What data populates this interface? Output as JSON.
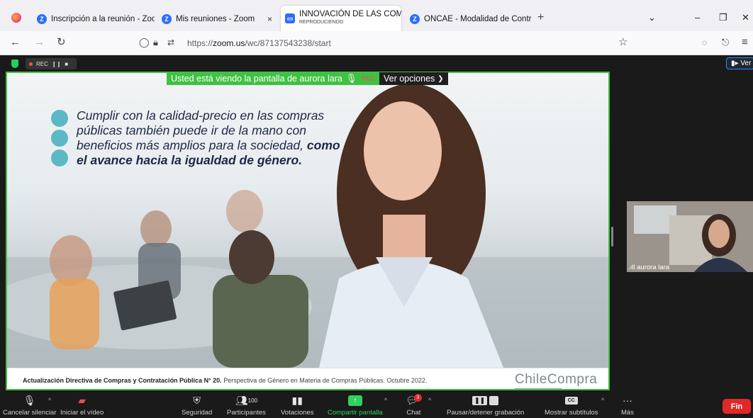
{
  "browser": {
    "tabs": [
      {
        "label": "Inscripción a la reunión - Zoom",
        "close": "×"
      },
      {
        "label": "Mis reuniones - Zoom",
        "close": "×"
      },
      {
        "label": "INNOVACIÓN DE LAS COMPRA",
        "sub": "REPRODUCIENDO",
        "close": "×"
      },
      {
        "label": "ONCAE - Modalidad de Contrat",
        "close": "×"
      }
    ],
    "new_tab": "+",
    "url_prefix": "https://",
    "url_domain": "zoom.us",
    "url_path": "/wc/87137543238/start"
  },
  "zoom": {
    "rec_indicator": "REC",
    "ver_button": "Ver",
    "viewing_banner": "Usted está viendo la pantalla de aurora lara",
    "banner_rec": "REC",
    "options_button": "Ver opciones",
    "participant_name": "aurora lara"
  },
  "slide": {
    "quote_plain": "Cumplir con la calidad-precio en las compras públicas también puede ir de la mano con beneficios más amplios para la sociedad,",
    "quote_bold": "como el avance hacia la igualdad de género.",
    "footer_bold": "Actualización Directiva de Compras y Contratación Pública N° 20.",
    "footer_plain": "Perspectiva de Género en Materia de Compras Públicas. Octubre 2022.",
    "brand": "ChileCompra"
  },
  "toolbar": {
    "mute": "Cancelar silenciar",
    "video": "Iniciar el vídeo",
    "security": "Seguridad",
    "participants": "Participantes",
    "participants_count": "100",
    "polls": "Votaciones",
    "share": "Compartir pantalla",
    "chat": "Chat",
    "chat_badge": "3",
    "record": "Pausar/detener grabación",
    "captions": "Mostrar subtítulos",
    "captions_icon": "CC",
    "more": "Más",
    "end": "Fin"
  },
  "colors": {
    "zoom_green": "#3fc142",
    "zoom_blue": "#2d6bff",
    "end_red": "#e02828",
    "slide_text": "#1b2847",
    "bubble": "#5cb8c5"
  }
}
